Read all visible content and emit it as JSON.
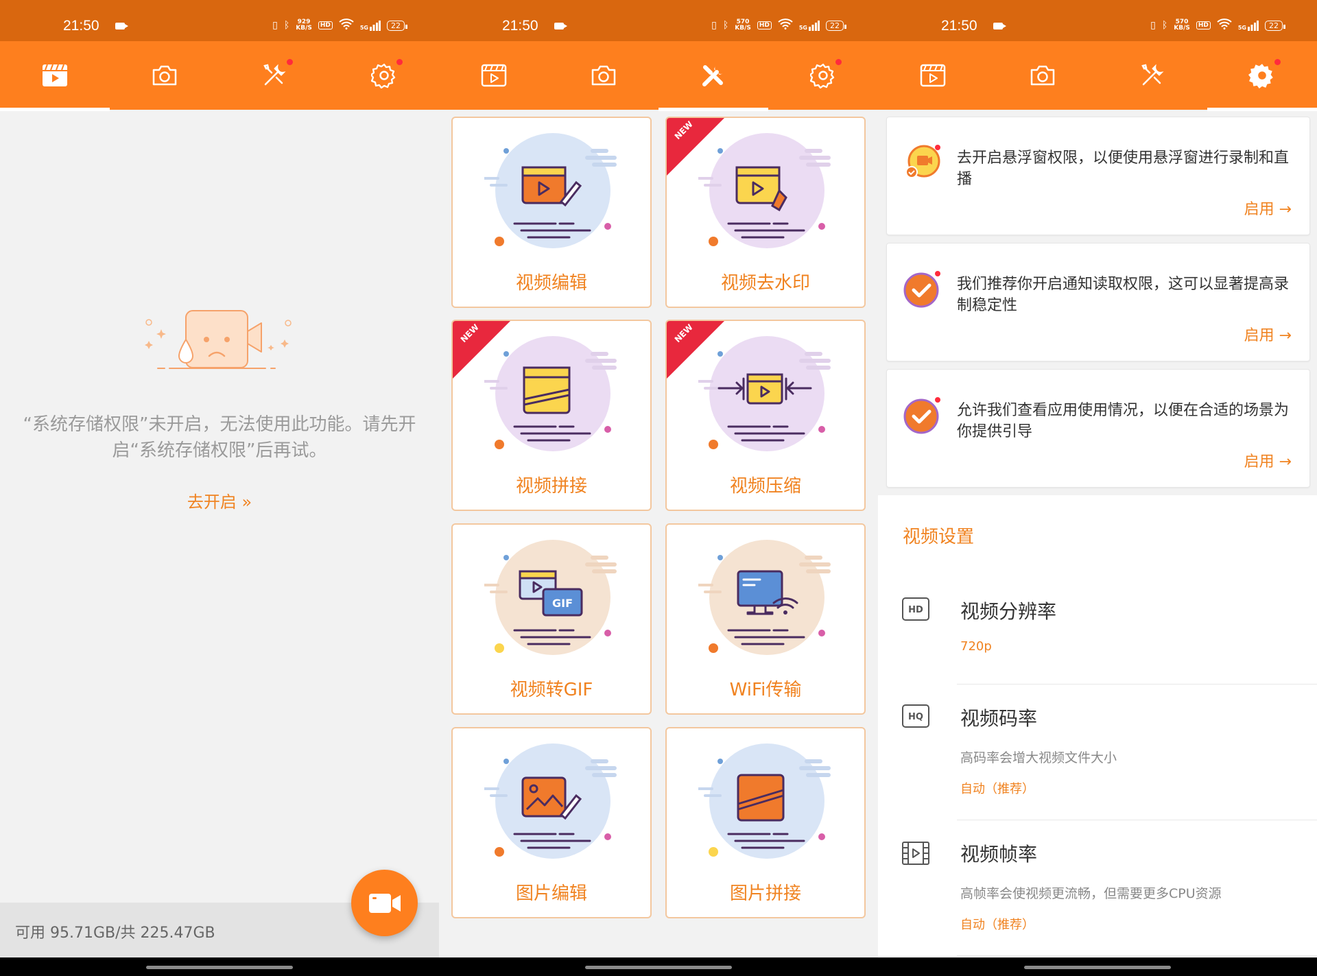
{
  "status_bar": {
    "time": "21:50",
    "speed_p1": "929",
    "speed_p2": "570",
    "speed_p3": "570",
    "speed_unit": "KB/S",
    "hd": "HD",
    "net": "5G",
    "battery": "22"
  },
  "nav_tabs": [
    "videos",
    "screenshots",
    "tools",
    "settings"
  ],
  "panel1": {
    "message": "“系统存储权限”未开启，无法使用此功能。请先开启“系统存储权限”后再试。",
    "open_link": "去开启 »",
    "storage": "可用 95.71GB/共 225.47GB"
  },
  "panel2": {
    "tools": [
      {
        "label": "视频编辑",
        "new": false
      },
      {
        "label": "视频去水印",
        "new": true
      },
      {
        "label": "视频拼接",
        "new": true
      },
      {
        "label": "视频压缩",
        "new": true
      },
      {
        "label": "视频转GIF",
        "new": false
      },
      {
        "label": "WiFi传输",
        "new": false
      },
      {
        "label": "图片编辑",
        "new": false
      },
      {
        "label": "图片拼接",
        "new": false
      }
    ],
    "new_tag": "NEW",
    "gif_text": "GIF"
  },
  "panel3": {
    "cards": [
      {
        "text": "去开启悬浮窗权限，以便使用悬浮窗进行录制和直播",
        "button": "启用 →"
      },
      {
        "text": "我们推荐你开启通知读取权限，这可以显著提高录制稳定性",
        "button": "启用 →"
      },
      {
        "text": "允许我们查看应用使用情况，以便在合适的场景为你提供引导",
        "button": "启用 →"
      }
    ],
    "section_title": "视频设置",
    "settings": [
      {
        "icon_text": "HD",
        "title": "视频分辨率",
        "subtitle": "",
        "value": "720p"
      },
      {
        "icon_text": "HQ",
        "title": "视频码率",
        "subtitle": "高码率会增大视频文件大小",
        "value": "自动（推荐）"
      },
      {
        "icon_text": "",
        "title": "视频帧率",
        "subtitle": "高帧率会使视频更流畅，但需要更多CPU资源",
        "value": "自动（推荐）"
      }
    ]
  },
  "colors": {
    "status_bar": "#d9670f",
    "nav_bar": "#fe7f1e",
    "accent": "#f08321",
    "badge": "#ff2b3c",
    "background": "#f2f2f2"
  }
}
